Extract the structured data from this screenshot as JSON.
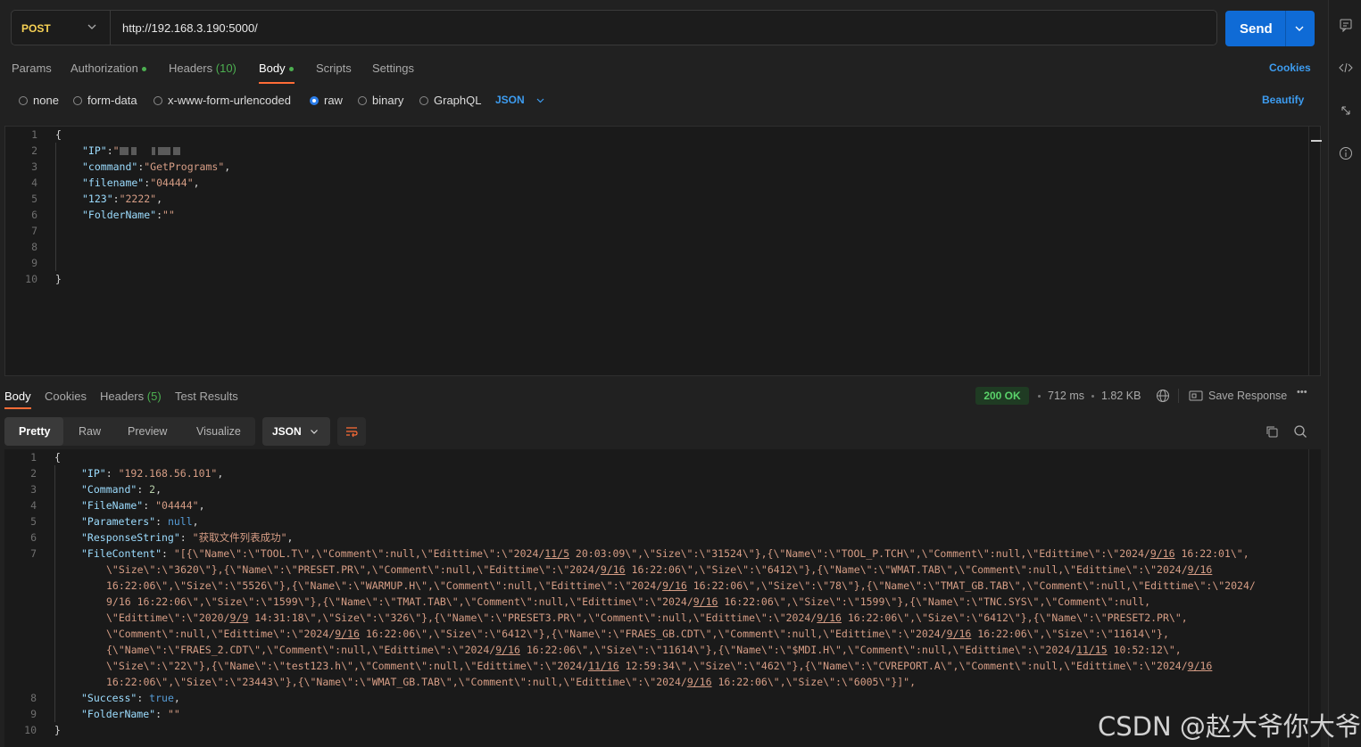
{
  "request": {
    "method": "POST",
    "url": "http://192.168.3.190:5000/",
    "send_label": "Send"
  },
  "tabs": {
    "params": "Params",
    "authorization": "Authorization",
    "headers": "Headers",
    "headers_count": "(10)",
    "body": "Body",
    "scripts": "Scripts",
    "settings": "Settings",
    "cookies": "Cookies"
  },
  "body_types": {
    "none": "none",
    "form_data": "form-data",
    "urlencoded": "x-www-form-urlencoded",
    "raw": "raw",
    "binary": "binary",
    "graphql": "GraphQL",
    "format": "JSON",
    "beautify": "Beautify"
  },
  "request_body": {
    "line_numbers": [
      "1",
      "2",
      "3",
      "4",
      "5",
      "6",
      "7",
      "8",
      "9",
      "10"
    ],
    "open": "{",
    "close": "}",
    "ip_key": "\"IP\"",
    "command_key": "\"command\"",
    "command_val": "\"GetPrograms\"",
    "filename_key": "\"filename\"",
    "filename_val": "\"04444\"",
    "k123_key": "\"123\"",
    "k123_val": "\"2222\"",
    "folder_key": "\"FolderName\"",
    "folder_val": "\"\""
  },
  "response_tabs": {
    "body": "Body",
    "cookies": "Cookies",
    "headers": "Headers",
    "headers_count": "(5)",
    "test_results": "Test Results",
    "status": "200 OK",
    "time": "712 ms",
    "size": "1.82 KB",
    "save_response": "Save Response",
    "more": "•••"
  },
  "response_format": {
    "pretty": "Pretty",
    "raw": "Raw",
    "preview": "Preview",
    "visualize": "Visualize",
    "json": "JSON"
  },
  "response_body": {
    "line_numbers": [
      "1",
      "2",
      "3",
      "4",
      "5",
      "6",
      "7",
      "",
      "",
      "",
      "",
      "",
      "",
      "",
      "",
      "8",
      "9",
      "10"
    ],
    "open": "{",
    "close": "}",
    "ip_key": "\"IP\"",
    "ip_val": "\"192.168.56.101\"",
    "command_key": "\"Command\"",
    "command_val": "2",
    "filename_key": "\"FileName\"",
    "filename_val": "\"04444\"",
    "params_key": "\"Parameters\"",
    "params_val": "null",
    "resp_key": "\"ResponseString\"",
    "resp_val": "\"获取文件列表成功\"",
    "fc_key": "\"FileContent\"",
    "fc_lines": [
      "\"[{\\\"Name\\\":\\\"TOOL.T\\\",\\\"Comment\\\":null,\\\"Edittime\\\":\\\"2024/11/5 20:03:09\\\",\\\"Size\\\":\\\"31524\\\"},{\\\"Name\\\":\\\"TOOL_P.TCH\\\",\\\"Comment\\\":null,\\\"Edittime\\\":\\\"2024/9/16 16:22:01\\\",",
      "\\\"Size\\\":\\\"3620\\\"},{\\\"Name\\\":\\\"PRESET.PR\\\",\\\"Comment\\\":null,\\\"Edittime\\\":\\\"2024/9/16 16:22:06\\\",\\\"Size\\\":\\\"6412\\\"},{\\\"Name\\\":\\\"WMAT.TAB\\\",\\\"Comment\\\":null,\\\"Edittime\\\":\\\"2024/9/16",
      "16:22:06\\\",\\\"Size\\\":\\\"5526\\\"},{\\\"Name\\\":\\\"WARMUP.H\\\",\\\"Comment\\\":null,\\\"Edittime\\\":\\\"2024/9/16 16:22:06\\\",\\\"Size\\\":\\\"78\\\"},{\\\"Name\\\":\\\"TMAT_GB.TAB\\\",\\\"Comment\\\":null,\\\"Edittime\\\":\\\"2024/",
      "9/16 16:22:06\\\",\\\"Size\\\":\\\"1599\\\"},{\\\"Name\\\":\\\"TMAT.TAB\\\",\\\"Comment\\\":null,\\\"Edittime\\\":\\\"2024/9/16 16:22:06\\\",\\\"Size\\\":\\\"1599\\\"},{\\\"Name\\\":\\\"TNC.SYS\\\",\\\"Comment\\\":null,",
      "\\\"Edittime\\\":\\\"2020/9/9 14:31:18\\\",\\\"Size\\\":\\\"326\\\"},{\\\"Name\\\":\\\"PRESET3.PR\\\",\\\"Comment\\\":null,\\\"Edittime\\\":\\\"2024/9/16 16:22:06\\\",\\\"Size\\\":\\\"6412\\\"},{\\\"Name\\\":\\\"PRESET2.PR\\\",",
      "\\\"Comment\\\":null,\\\"Edittime\\\":\\\"2024/9/16 16:22:06\\\",\\\"Size\\\":\\\"6412\\\"},{\\\"Name\\\":\\\"FRAES_GB.CDT\\\",\\\"Comment\\\":null,\\\"Edittime\\\":\\\"2024/9/16 16:22:06\\\",\\\"Size\\\":\\\"11614\\\"},",
      "{\\\"Name\\\":\\\"FRAES_2.CDT\\\",\\\"Comment\\\":null,\\\"Edittime\\\":\\\"2024/9/16 16:22:06\\\",\\\"Size\\\":\\\"11614\\\"},{\\\"Name\\\":\\\"$MDI.H\\\",\\\"Comment\\\":null,\\\"Edittime\\\":\\\"2024/11/15 10:52:12\\\",",
      "\\\"Size\\\":\\\"22\\\"},{\\\"Name\\\":\\\"test123.h\\\",\\\"Comment\\\":null,\\\"Edittime\\\":\\\"2024/11/16 12:59:34\\\",\\\"Size\\\":\\\"462\\\"},{\\\"Name\\\":\\\"CVREPORT.A\\\",\\\"Comment\\\":null,\\\"Edittime\\\":\\\"2024/9/16",
      "16:22:06\\\",\\\"Size\\\":\\\"23443\\\"},{\\\"Name\\\":\\\"WMAT_GB.TAB\\\",\\\"Comment\\\":null,\\\"Edittime\\\":\\\"2024/9/16 16:22:06\\\",\\\"Size\\\":\\\"6005\\\"}]\","
    ],
    "success_key": "\"Success\"",
    "success_val": "true",
    "folder_key": "\"FolderName\"",
    "folder_val": "\"\""
  },
  "watermark": "CSDN @赵大爷你大爷",
  "icons": {
    "method_dropdown": "chevron-down-icon",
    "send_dropdown": "chevron-down-icon",
    "rail": [
      "comment-icon",
      "code-icon",
      "resize-icon",
      "info-icon"
    ],
    "globe": "globe-icon",
    "save": "save-response-icon",
    "wrap": "wrap-lines-icon",
    "copy": "copy-icon",
    "search": "search-icon"
  },
  "colors": {
    "method": "#f7d154",
    "send": "#0f6bd6",
    "accent": "#ff6c37",
    "link": "#3d9cf0",
    "status_ok": "#5ad26a"
  }
}
